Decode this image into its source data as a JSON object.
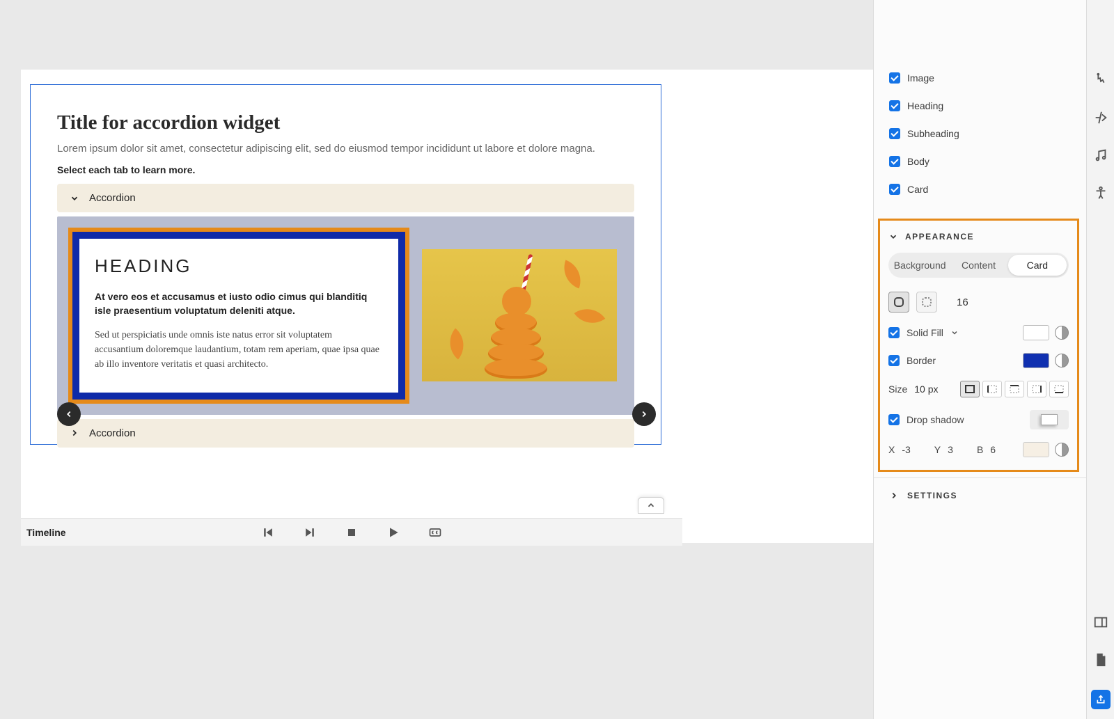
{
  "canvas": {
    "title": "Title for accordion widget",
    "subtitle": "Lorem ipsum dolor sit amet, consectetur adipiscing elit, sed do eiusmod tempor incididunt ut labore et dolore magna.",
    "instruction": "Select each tab to learn more.",
    "acc_open_label": "Accordion",
    "acc_closed_label": "Accordion",
    "card": {
      "heading": "HEADING",
      "subheading": "At vero eos et accusamus et iusto odio cimus qui blanditiq isle praesentium voluptatum deleniti atque.",
      "body": "Sed ut perspiciatis unde omnis iste natus error sit voluptatem accusantium doloremque laudantium, totam rem aperiam, quae ipsa quae ab illo inventore veritatis et quasi architecto."
    }
  },
  "components": {
    "image": "Image",
    "heading": "Heading",
    "subheading": "Subheading",
    "body": "Body",
    "card": "Card"
  },
  "appearance": {
    "section": "APPEARANCE",
    "tabs": {
      "background": "Background",
      "content": "Content",
      "card": "Card"
    },
    "radius_value": "16",
    "solid_fill": "Solid Fill",
    "fill_color": "#ffffff",
    "border": "Border",
    "border_color": "#1030b0",
    "size_label": "Size",
    "size_value": "10 px",
    "drop_shadow": "Drop shadow",
    "x_label": "X",
    "x_value": "-3",
    "y_label": "Y",
    "y_value": "3",
    "b_label": "B",
    "b_value": "6",
    "shadow_color": "#f6efe4"
  },
  "settings_section": "SETTINGS",
  "timeline_label": "Timeline"
}
